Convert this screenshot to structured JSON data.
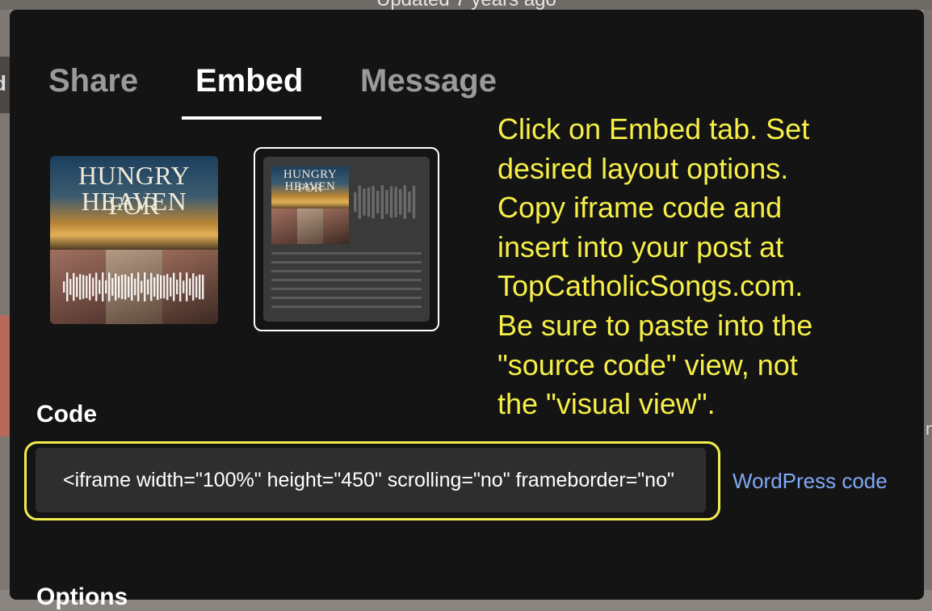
{
  "background": {
    "updated_text": "Updated 7 years ago"
  },
  "tabs": [
    {
      "label": "Share",
      "active": false
    },
    {
      "label": "Embed",
      "active": true
    },
    {
      "label": "Message",
      "active": false
    }
  ],
  "layouts": {
    "artwork": {
      "title_line1": "HUNGRY FOR",
      "title_line2": "HEAVEN"
    },
    "classic": {
      "title_line1": "HUNGRY FOR",
      "title_line2": "HEAVEN",
      "selected": true
    }
  },
  "instructions": [
    "Click on Embed tab. Set",
    "desired layout options.",
    "Copy iframe code and",
    "insert into your post at",
    "TopCatholicSongs.com.",
    "Be sure to paste into the",
    "\"source code\" view, not",
    "the \"visual view\"."
  ],
  "code": {
    "label": "Code",
    "value": "<iframe width=\"100%\" height=\"450\" scrolling=\"no\" frameborder=\"no\""
  },
  "wordpress_link": "WordPress code",
  "options_label": "Options",
  "colors": {
    "modal_bg": "#141414",
    "annotation_yellow": "#f6ef48",
    "link_blue": "#7fa9f5",
    "active_tab": "#ffffff",
    "inactive_tab": "#9a9a9a"
  }
}
